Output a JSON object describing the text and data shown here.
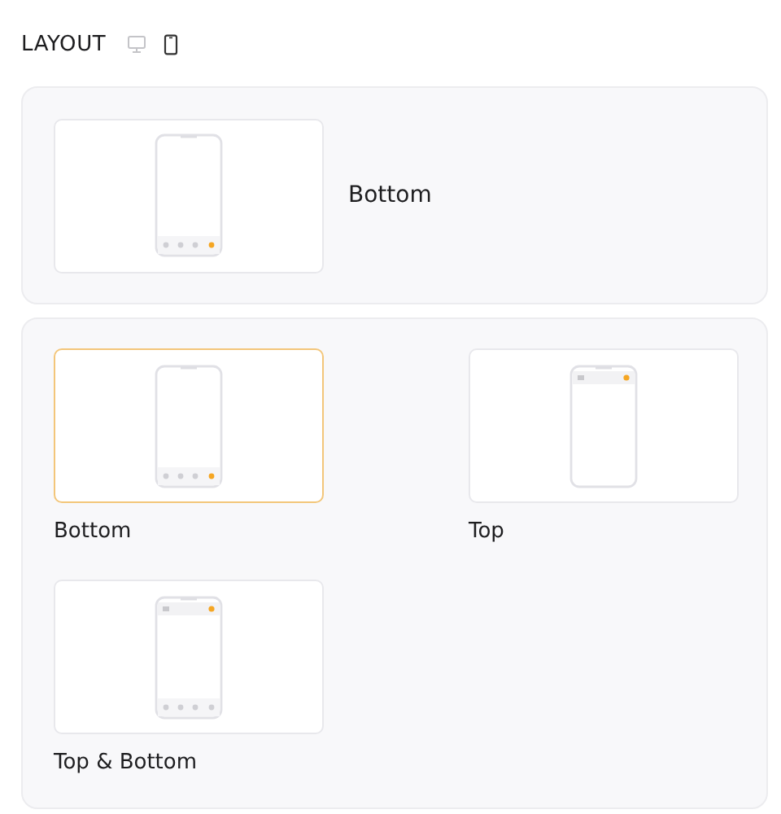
{
  "header": {
    "title": "LAYOUT",
    "view_toggles": [
      {
        "kind": "desktop",
        "selected": false
      },
      {
        "kind": "mobile",
        "selected": true
      }
    ]
  },
  "current": {
    "label": "Bottom",
    "kind": "bottom"
  },
  "options": [
    {
      "label": "Bottom",
      "kind": "bottom",
      "selected": true
    },
    {
      "label": "Top",
      "kind": "top",
      "selected": false
    },
    {
      "label": "Top & Bottom",
      "kind": "both",
      "selected": false
    }
  ]
}
